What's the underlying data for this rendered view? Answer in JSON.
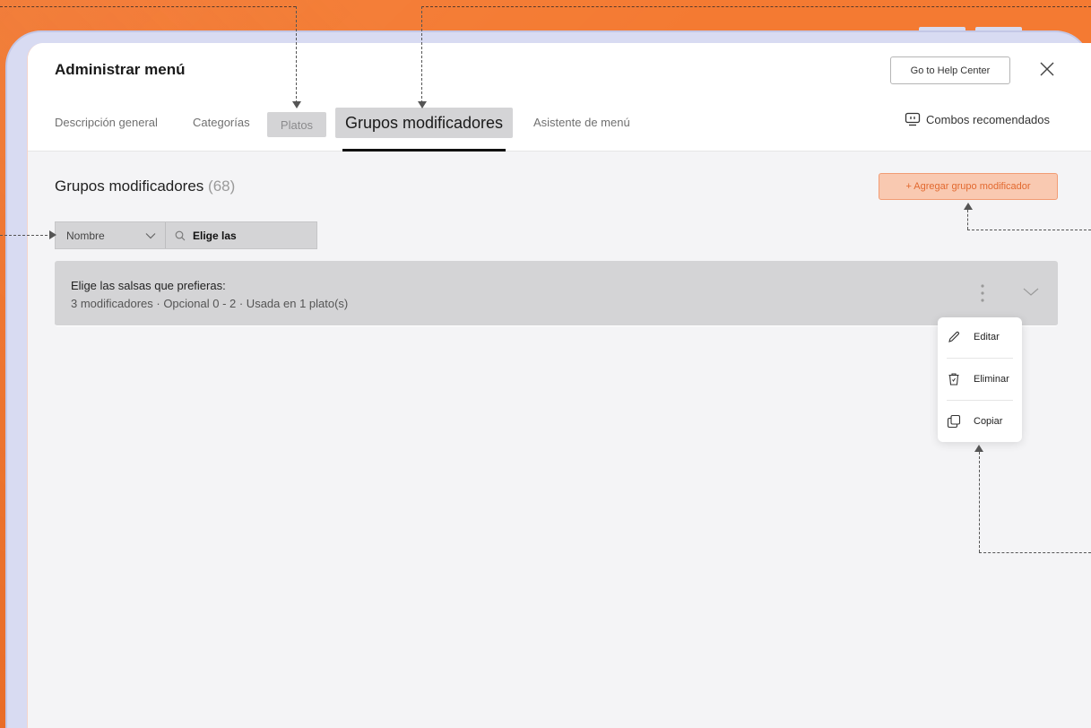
{
  "header": {
    "title": "Administrar menú",
    "help_label": "Go to Help Center"
  },
  "tabs": {
    "items": [
      "Descripción general",
      "Categorías",
      "Platos",
      "Grupos modificadores",
      "Asistente de menú"
    ],
    "active": "Grupos modificadores",
    "combos_label": "Combos recomendados"
  },
  "section": {
    "title": "Grupos modificadores",
    "count": "(68)",
    "add_label": "+ Agregar grupo modificador"
  },
  "filter": {
    "select_value": "Nombre",
    "search_value": "Elige las"
  },
  "group": {
    "name": "Elige las salsas que prefieras:",
    "meta": "3 modificadores  ·  Opcional 0 - 2  ·  Usada en 1 plato(s)"
  },
  "context_menu": {
    "items": [
      {
        "label": "Editar",
        "icon": "pencil-icon"
      },
      {
        "label": "Eliminar",
        "icon": "trash-icon"
      },
      {
        "label": "Copiar",
        "icon": "copy-icon"
      }
    ]
  },
  "colors": {
    "background": "#f47a32",
    "accent": "#e2692f",
    "accent_fill": "#f9c9b1",
    "selected_fill": "#d4d4d6"
  }
}
